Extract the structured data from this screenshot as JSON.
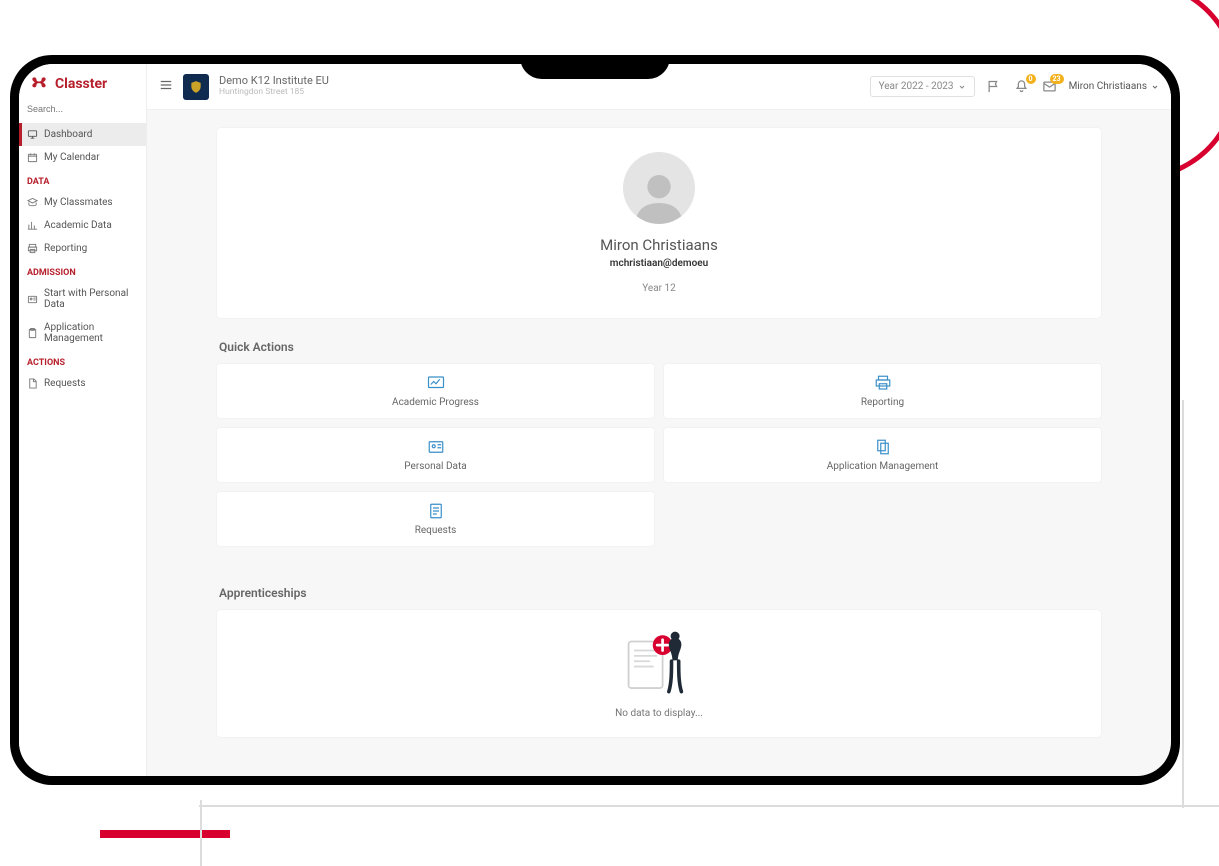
{
  "brand": {
    "name": "Classter"
  },
  "sidebar": {
    "search_placeholder": "Search...",
    "items": [
      {
        "label": "Dashboard"
      },
      {
        "label": "My Calendar"
      }
    ],
    "section_data": "DATA",
    "data_items": [
      {
        "label": "My Classmates"
      },
      {
        "label": "Academic Data"
      },
      {
        "label": "Reporting"
      }
    ],
    "section_admission": "ADMISSION",
    "admission_items": [
      {
        "label": "Start with Personal Data"
      },
      {
        "label": "Application Management"
      }
    ],
    "section_actions": "ACTIONS",
    "action_items": [
      {
        "label": "Requests"
      }
    ]
  },
  "topbar": {
    "institute_name": "Demo K12 Institute EU",
    "institute_addr": "Huntingdon Street 185",
    "year_selected": "Year 2022 - 2023",
    "notif_badge": "0",
    "mail_badge": "23",
    "user_name": "Miron Christiaans"
  },
  "profile": {
    "name": "Miron Christiaans",
    "email": "mchristiaan@demoeu",
    "year": "Year 12"
  },
  "quick_actions": {
    "title": "Quick Actions",
    "cards": [
      {
        "label": "Academic Progress"
      },
      {
        "label": "Reporting"
      },
      {
        "label": "Personal Data"
      },
      {
        "label": "Application Management"
      },
      {
        "label": "Requests"
      }
    ]
  },
  "apprenticeships": {
    "title": "Apprenticeships",
    "empty_text": "No data to display..."
  },
  "colors": {
    "brand": "#b61f2b",
    "accent": "#3a8fc9",
    "badge": "#f3b21d"
  }
}
